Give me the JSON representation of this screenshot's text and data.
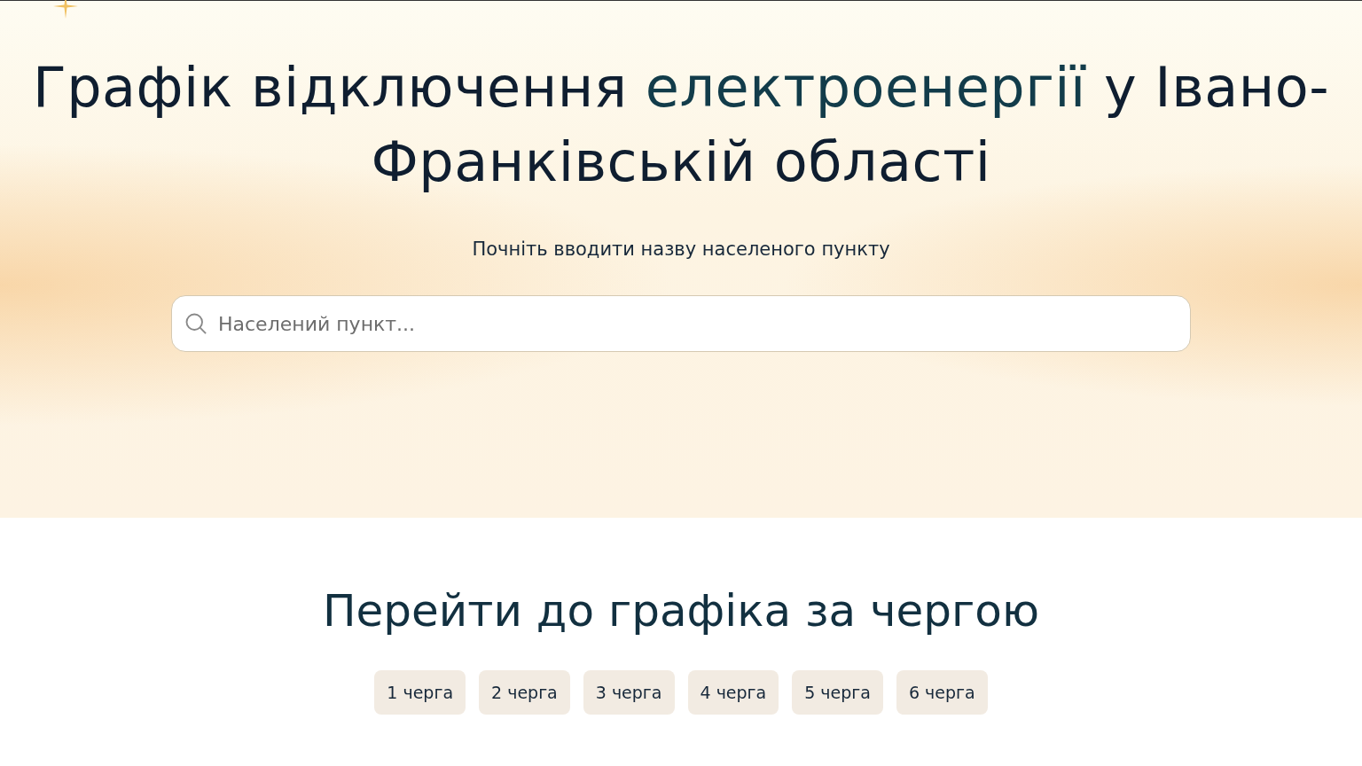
{
  "hero": {
    "title": [
      {
        "text": "Графік відключення ",
        "accent": false
      },
      {
        "text": "електроенергії",
        "accent": true
      },
      {
        "text": " у Івано-Франківській області",
        "accent": false
      }
    ],
    "subtitle": "Почніть вводити назву населеного пункту",
    "search": {
      "placeholder": "Населений пункт..."
    }
  },
  "queues": {
    "heading": "Перейти до графіка за чергою",
    "items": [
      {
        "label": "1 черга"
      },
      {
        "label": "2 черга"
      },
      {
        "label": "3 черга"
      },
      {
        "label": "4 черга"
      },
      {
        "label": "5 черга"
      },
      {
        "label": "6 черга"
      }
    ]
  }
}
